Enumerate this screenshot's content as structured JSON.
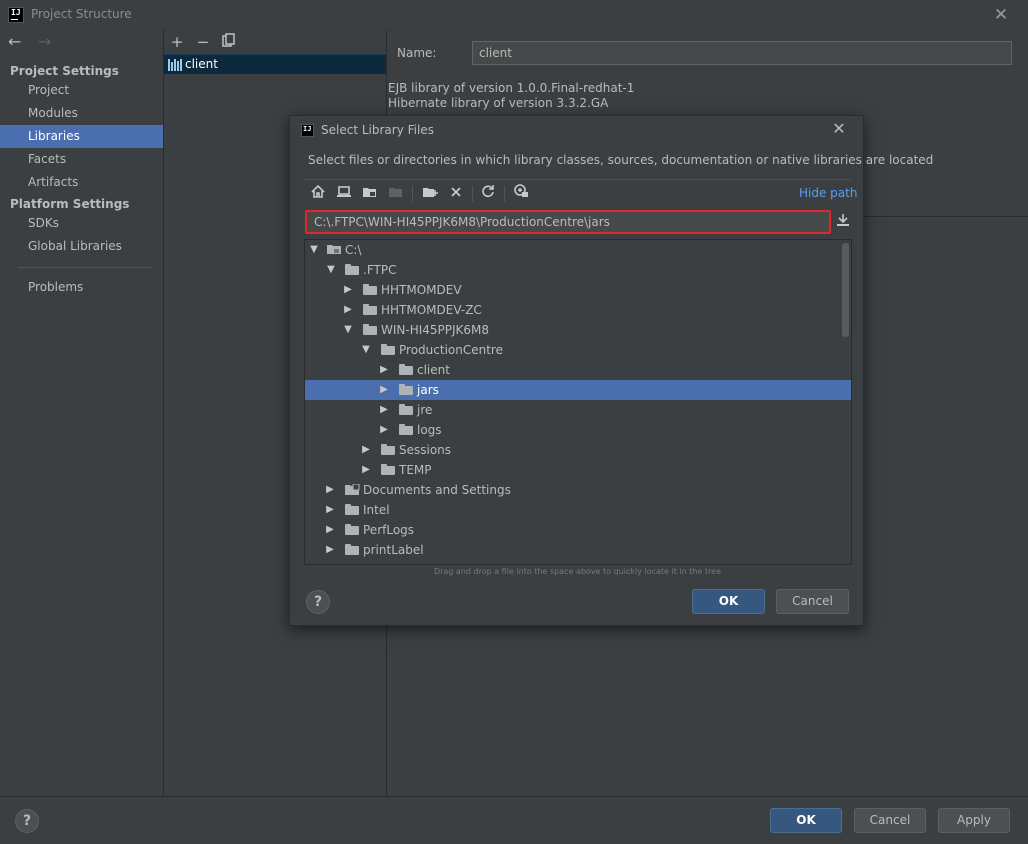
{
  "window": {
    "title": "Project Structure"
  },
  "sidebar": {
    "project_settings_heading": "Project Settings",
    "platform_settings_heading": "Platform Settings",
    "items": [
      {
        "label": "Project",
        "selected": false
      },
      {
        "label": "Modules",
        "selected": false
      },
      {
        "label": "Libraries",
        "selected": true
      },
      {
        "label": "Facets",
        "selected": false
      },
      {
        "label": "Artifacts",
        "selected": false
      },
      {
        "label": "SDKs",
        "selected": false
      },
      {
        "label": "Global Libraries",
        "selected": false
      },
      {
        "label": "Problems",
        "selected": false
      }
    ]
  },
  "libraries": {
    "items": [
      {
        "label": "client"
      }
    ]
  },
  "details": {
    "name_label": "Name:",
    "name_value": "client",
    "info_lines": [
      "EJB library of version 1.0.0.Final-redhat-1",
      "Hibernate library of version 3.3.2.GA"
    ]
  },
  "dialog": {
    "title": "Select Library Files",
    "description": "Select files or directories in which library classes, sources, documentation or native libraries are located",
    "hide_path_label": "Hide path",
    "path_value": "C:\\.FTPC\\WIN-HI45PPJK6M8\\ProductionCentre\\jars",
    "tree": [
      {
        "label": "C:\\",
        "expanded": true
      },
      {
        "label": ".FTPC",
        "expanded": true
      },
      {
        "label": "HHTMOMDEV",
        "expanded": false
      },
      {
        "label": "HHTMOMDEV-ZC",
        "expanded": false
      },
      {
        "label": "WIN-HI45PPJK6M8",
        "expanded": true
      },
      {
        "label": "ProductionCentre",
        "expanded": true
      },
      {
        "label": "client",
        "expanded": false
      },
      {
        "label": "jars",
        "expanded": false,
        "selected": true
      },
      {
        "label": "jre",
        "expanded": false
      },
      {
        "label": "logs",
        "expanded": false
      },
      {
        "label": "Sessions",
        "expanded": false
      },
      {
        "label": "TEMP",
        "expanded": false
      },
      {
        "label": "Documents and Settings",
        "expanded": false
      },
      {
        "label": "Intel",
        "expanded": false
      },
      {
        "label": "PerfLogs",
        "expanded": false
      },
      {
        "label": "printLabel",
        "expanded": false
      }
    ],
    "drag_hint": "Drag and drop a file into the space above to quickly locate it in the tree",
    "ok_label": "OK",
    "cancel_label": "Cancel",
    "help_label": "?"
  },
  "footer": {
    "help_label": "?",
    "ok_label": "OK",
    "cancel_label": "Cancel",
    "apply_label": "Apply"
  },
  "colors": {
    "background": "#3c3f41",
    "selection": "#4b6eaf",
    "primary_button": "#365880",
    "link": "#589df6",
    "highlight_border": "#e0282a"
  }
}
